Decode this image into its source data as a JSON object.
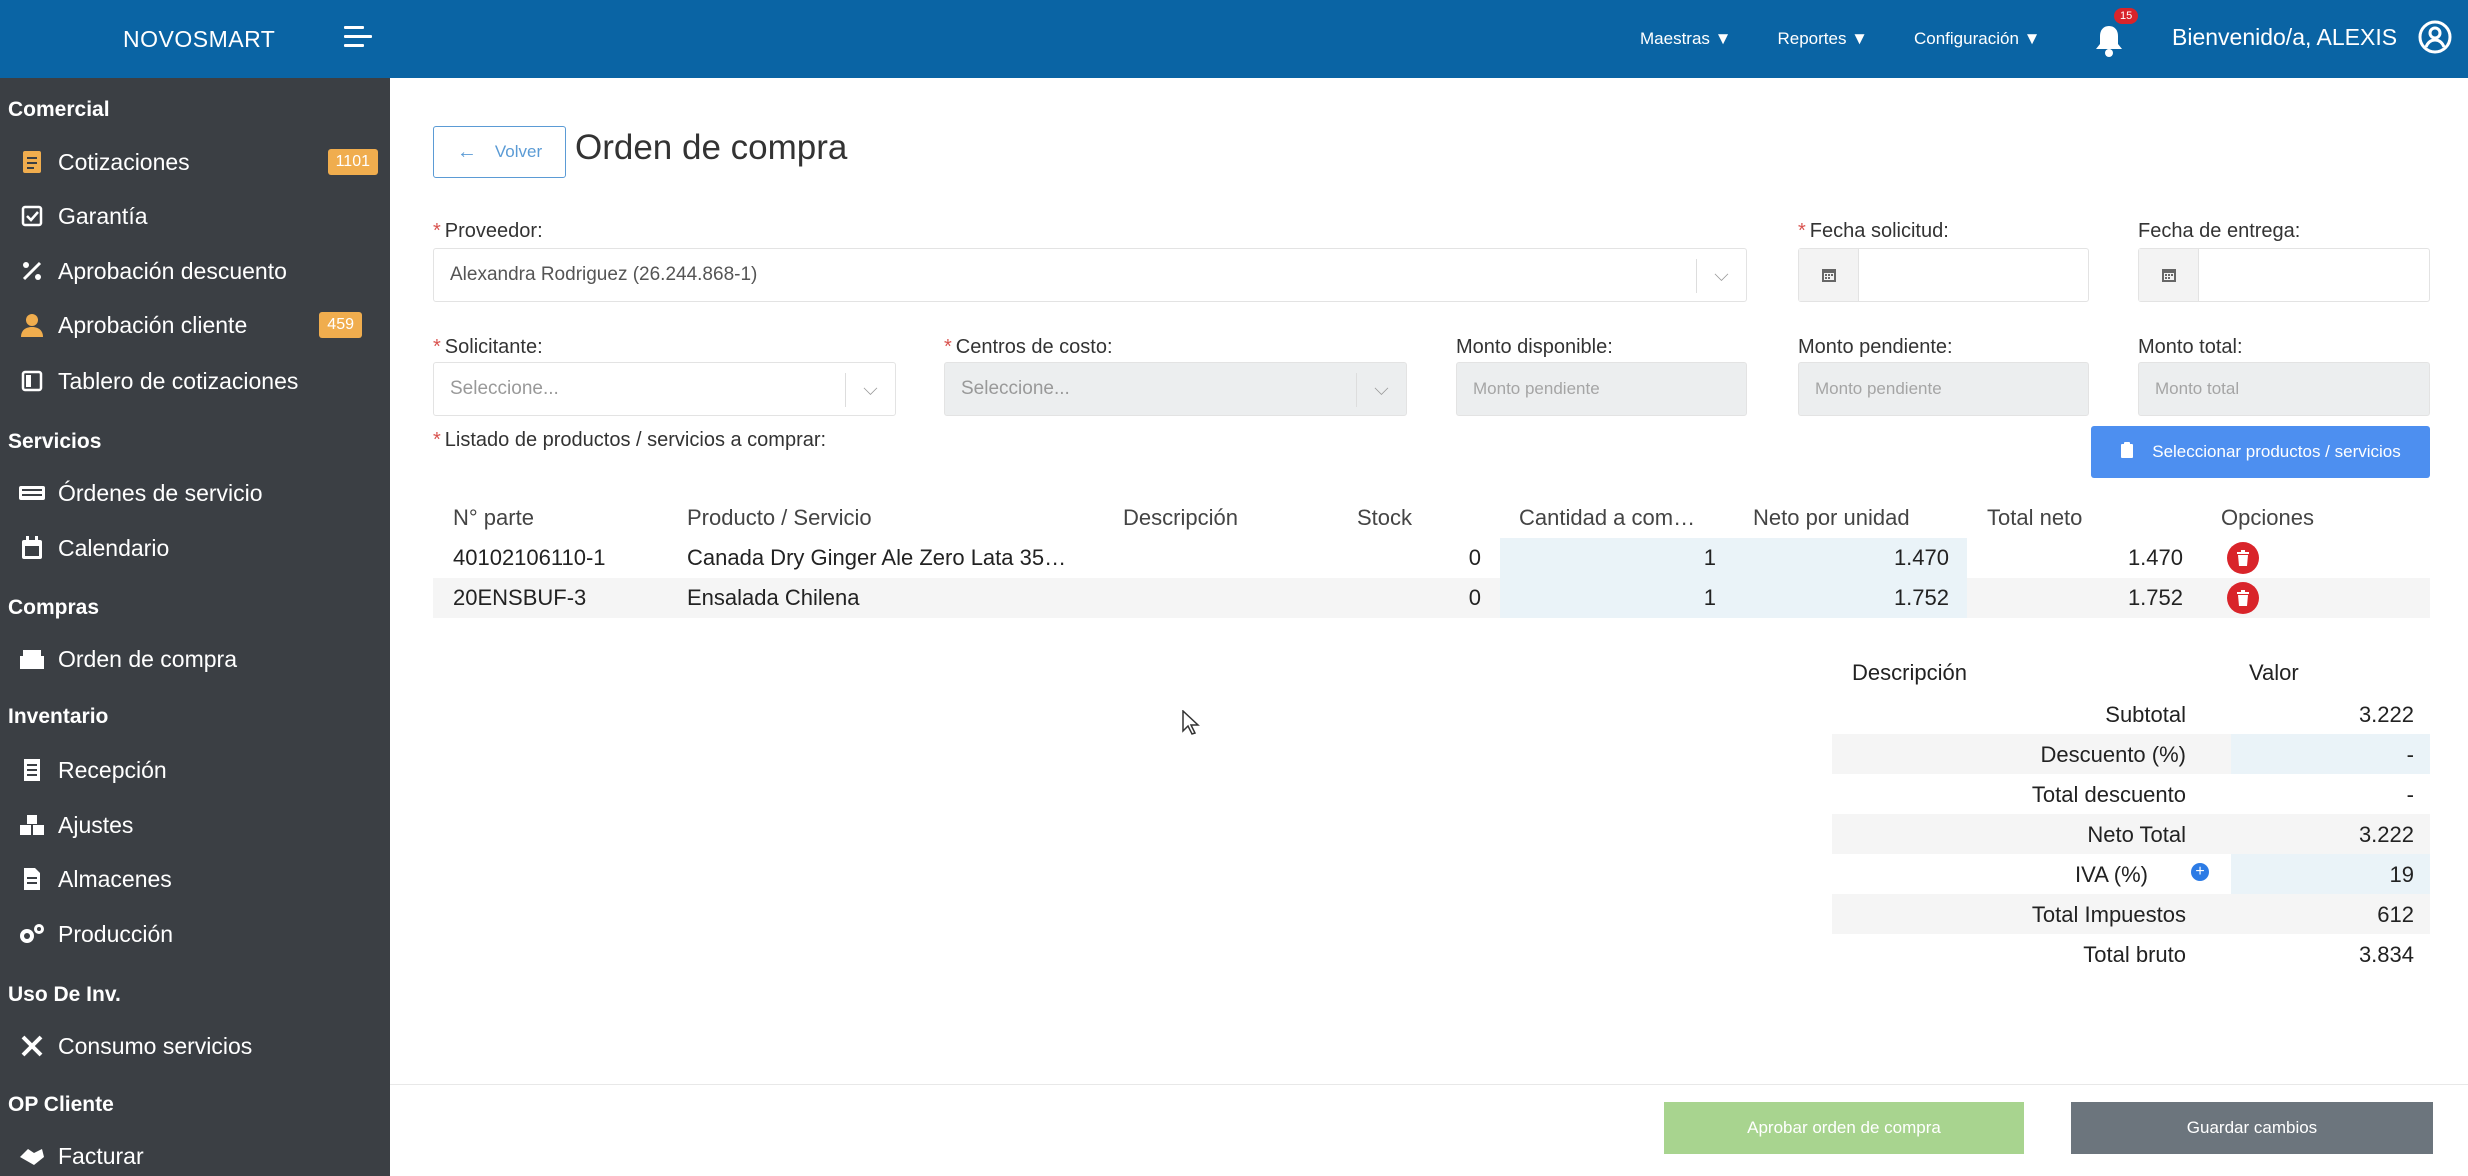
{
  "app": {
    "brand": "NOVOSMART"
  },
  "topnav": {
    "items": [
      "Maestras ▼",
      "Reportes ▼",
      "Configuración ▼"
    ],
    "notification_count": "15",
    "welcome": "Bienvenido/a, ALEXIS"
  },
  "sidebar": {
    "sections": [
      "Comercial",
      "Servicios",
      "Compras",
      "Inventario",
      "Uso De Inv.",
      "OP Cliente"
    ],
    "items": [
      {
        "label": "Cotizaciones",
        "icon": "document-icon",
        "badge": "1101"
      },
      {
        "label": "Garantía",
        "icon": "checkbox-icon"
      },
      {
        "label": "Aprobación descuento",
        "icon": "percent-icon"
      },
      {
        "label": "Aprobación cliente",
        "icon": "user-icon",
        "badge": "459"
      },
      {
        "label": "Tablero de cotizaciones",
        "icon": "board-icon"
      },
      {
        "label": "Órdenes de servicio",
        "icon": "keyboard-icon"
      },
      {
        "label": "Calendario",
        "icon": "calendar-icon"
      },
      {
        "label": "Orden de compra",
        "icon": "boxes-icon"
      },
      {
        "label": "Recepción",
        "icon": "receipt-icon"
      },
      {
        "label": "Ajustes",
        "icon": "cubes-icon"
      },
      {
        "label": "Almacenes",
        "icon": "file-icon"
      },
      {
        "label": "Producción",
        "icon": "gears-icon"
      },
      {
        "label": "Consumo servicios",
        "icon": "tools-icon"
      },
      {
        "label": "Facturar",
        "icon": "handshake-icon"
      }
    ]
  },
  "page": {
    "back_label": "Volver",
    "title": "Orden de compra"
  },
  "form": {
    "proveedor_label": "Proveedor:",
    "proveedor_value": "Alexandra Rodriguez (26.244.868-1)",
    "fecha_solicitud_label": "Fecha solicitud:",
    "fecha_entrega_label": "Fecha de entrega:",
    "solicitante_label": "Solicitante:",
    "solicitante_placeholder": "Seleccione...",
    "centros_label": "Centros de costo:",
    "centros_placeholder": "Seleccione...",
    "monto_disponible_label": "Monto disponible:",
    "monto_disponible_placeholder": "Monto pendiente",
    "monto_pendiente_label": "Monto pendiente:",
    "monto_pendiente_placeholder": "Monto pendiente",
    "monto_total_label": "Monto total:",
    "monto_total_placeholder": "Monto total",
    "listado_label": "Listado de productos / servicios a comprar:",
    "select_products_label": "Seleccionar productos / servicios"
  },
  "products": {
    "headers": [
      "N° parte",
      "Producto / Servicio",
      "Descripción",
      "Stock",
      "Cantidad a com…",
      "Neto por unidad",
      "Total neto",
      "Opciones"
    ],
    "rows": [
      {
        "parte": "40102106110-1",
        "producto": "Canada Dry Ginger Ale Zero Lata 35…",
        "descripcion": "",
        "stock": "0",
        "cantidad": "1",
        "neto_unidad": "1.470",
        "total_neto": "1.470"
      },
      {
        "parte": "20ENSBUF-3",
        "producto": "Ensalada Chilena",
        "descripcion": "",
        "stock": "0",
        "cantidad": "1",
        "neto_unidad": "1.752",
        "total_neto": "1.752"
      }
    ]
  },
  "totals": {
    "header_desc": "Descripción",
    "header_val": "Valor",
    "rows": [
      {
        "label": "Subtotal",
        "value": "3.222"
      },
      {
        "label": "Descuento (%)",
        "value": "-"
      },
      {
        "label": "Total descuento",
        "value": "-"
      },
      {
        "label": "Neto Total",
        "value": "3.222"
      },
      {
        "label": "IVA (%)",
        "value": "19"
      },
      {
        "label": "Total Impuestos",
        "value": "612"
      },
      {
        "label": "Total bruto",
        "value": "3.834"
      }
    ]
  },
  "footer": {
    "approve_label": "Aprobar orden de compra",
    "save_label": "Guardar cambios"
  },
  "colors": {
    "topbar": "#0a64a4",
    "sidebar": "#3b3f44",
    "badge": "#f0ad4e",
    "primary": "#4d8ff0",
    "approve": "#a8d48f",
    "save": "#6c757d",
    "danger": "#d9242a"
  }
}
